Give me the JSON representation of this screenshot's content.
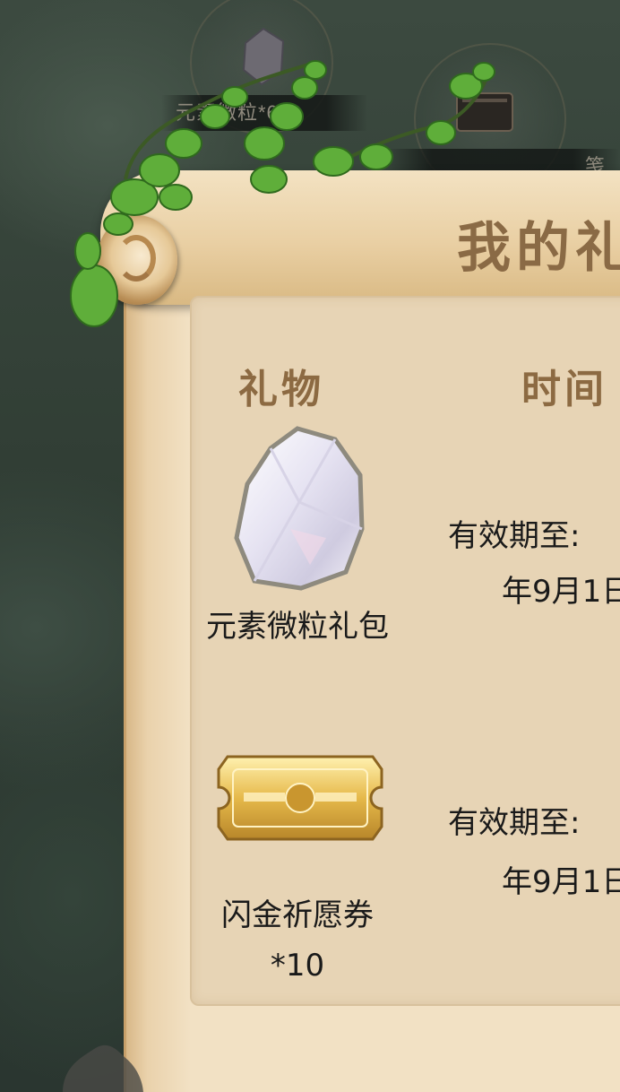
{
  "background": {
    "reward_strip": [
      {
        "caption": "元素微粒*600",
        "icon": "crystal-icon"
      },
      {
        "caption": "…笺",
        "icon": "book-icon"
      }
    ]
  },
  "panel": {
    "title": "我的礼",
    "headers": {
      "gift": "礼物",
      "time": "时间"
    },
    "gifts": [
      {
        "name": "元素微粒礼包",
        "icon": "crystal-icon",
        "valid_label": "有效期至:",
        "valid_date": "年9月1日"
      },
      {
        "name": "闪金祈愿券",
        "quantity": "*10",
        "icon": "gold-ticket-icon",
        "valid_label": "有效期至:",
        "valid_date": "年9月1日"
      }
    ]
  },
  "colors": {
    "parchment": "#f2e1c4",
    "inner_panel": "#e7d4b5",
    "header_text": "#8c6a42",
    "background": "#2f3c33"
  }
}
